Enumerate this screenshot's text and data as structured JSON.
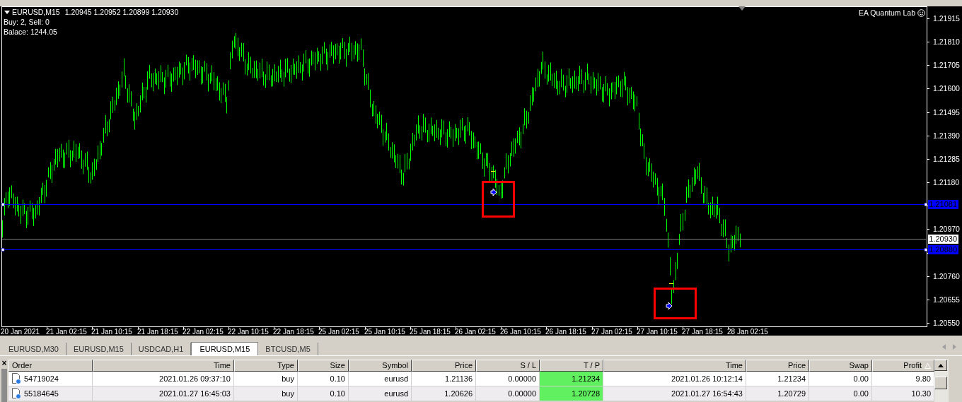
{
  "chart": {
    "symbol": "EURUSD,M15",
    "quotes": "1.20945 1.20952 1.20899 1.20930",
    "info_lines": [
      "Buy: 2, Sell: 0",
      "Balace: 1244.05"
    ],
    "expert_label": "EA Quantum Lab",
    "y_axis_labels": [
      "1.21915",
      "1.21810",
      "1.21705",
      "1.21600",
      "1.21495",
      "1.21390",
      "1.21285",
      "1.21180",
      "1.20970",
      "1.20760",
      "1.20655",
      "1.20550"
    ],
    "x_axis_labels": [
      "20 Jan 2021",
      "21 Jan 02:15",
      "21 Jan 10:15",
      "21 Jan 18:15",
      "22 Jan 02:15",
      "22 Jan 10:15",
      "22 Jan 18:15",
      "25 Jan 02:15",
      "25 Jan 10:15",
      "25 Jan 18:15",
      "26 Jan 02:15",
      "26 Jan 10:15",
      "26 Jan 18:15",
      "27 Jan 02:15",
      "27 Jan 10:15",
      "27 Jan 18:15",
      "28 Jan 02:15"
    ],
    "price_lines": [
      {
        "label": "1.21081",
        "kind": "order"
      },
      {
        "label": "1.20930",
        "kind": "bid"
      },
      {
        "label": "1.20880",
        "kind": "order"
      }
    ]
  },
  "tabs": [
    {
      "label": "EURUSD,M30",
      "selected": false
    },
    {
      "label": "EURUSD,M15",
      "selected": false
    },
    {
      "label": "USDCAD,H1",
      "selected": false
    },
    {
      "label": "EURUSD,M15",
      "selected": true
    },
    {
      "label": "BTCUSD,M5",
      "selected": false
    }
  ],
  "table": {
    "close_label": "×",
    "columns": [
      {
        "label": "Order",
        "highlighted": false,
        "sorted": false
      },
      {
        "label": "Time",
        "highlighted": false,
        "sorted": false
      },
      {
        "label": "Type",
        "highlighted": false,
        "sorted": false
      },
      {
        "label": "Size",
        "highlighted": false,
        "sorted": false
      },
      {
        "label": "Symbol",
        "highlighted": false,
        "sorted": false
      },
      {
        "label": "Price",
        "highlighted": false,
        "sorted": false
      },
      {
        "label": "S / L",
        "highlighted": false,
        "sorted": false
      },
      {
        "label": "T / P",
        "highlighted": true,
        "sorted": false
      },
      {
        "label": "Time",
        "highlighted": false,
        "sorted": false
      },
      {
        "label": "Price",
        "highlighted": false,
        "sorted": false
      },
      {
        "label": "Swap",
        "highlighted": false,
        "sorted": false
      },
      {
        "label": "Profit",
        "highlighted": false,
        "sorted": true
      }
    ],
    "rows": [
      {
        "cells": [
          "54719024",
          "2021.01.26 09:37:10",
          "buy",
          "0.10",
          "eurusd",
          "1.21136",
          "0.00000",
          "1.21234",
          "2021.01.26 10:12:14",
          "1.21234",
          "0.00",
          "9.80"
        ]
      },
      {
        "cells": [
          "55184645",
          "2021.01.27 16:45:03",
          "buy",
          "0.10",
          "eurusd",
          "1.20626",
          "0.00000",
          "1.20728",
          "2021.01.27 16:54:43",
          "1.20729",
          "0.00",
          "10.30"
        ]
      }
    ]
  }
}
